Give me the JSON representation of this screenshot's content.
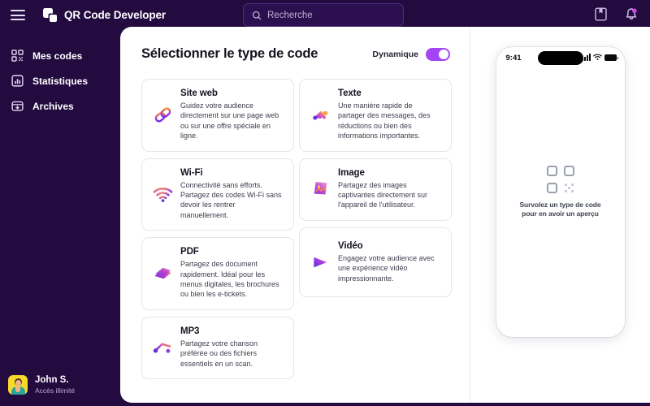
{
  "app": {
    "brand_name": "QR Code Developer",
    "brand_icon": "qr-squares-logo",
    "menu_icon": "hamburger-icon"
  },
  "search": {
    "placeholder": "Recherche",
    "value": "",
    "icon": "search-icon"
  },
  "topbar_actions": [
    {
      "name": "guide-book-icon",
      "label": ""
    },
    {
      "name": "notifications-bell-icon",
      "label": "",
      "has_badge": true
    }
  ],
  "sidebar": {
    "items": [
      {
        "label": "Mes codes",
        "icon": "qr-code-icon"
      },
      {
        "label": "Statistiques",
        "icon": "bar-chart-icon"
      },
      {
        "label": "Archives",
        "icon": "archive-box-icon"
      }
    ],
    "profile": {
      "name": "John S.",
      "subtitle": "Accès illimité",
      "avatar_icon": "user-avatar"
    }
  },
  "main": {
    "title": "Sélectionner le type de code",
    "toggle": {
      "label": "Dynamique",
      "state": "on",
      "accent": "#A445F5"
    },
    "cards_left": [
      {
        "title": "Site web",
        "desc": "Guidez votre audience directement sur une page web ou sur une offre spéciale en ligne.",
        "icon": "link-chain-icon"
      },
      {
        "title": "Wi-Fi",
        "desc": "Connectivité sans efforts. Partagez des codes Wi-Fi sans devoir les rentrer manuellement.",
        "icon": "wifi-icon"
      },
      {
        "title": "PDF",
        "desc": "Partagez des document rapidement. Idéal pour les menus digitales, les brochures ou bien les e-tickets.",
        "icon": "pdf-document-icon"
      },
      {
        "title": "MP3",
        "desc": "Partagez votre chanson préférée ou des fichiers essentiels en un scan.",
        "icon": "music-note-icon"
      }
    ],
    "cards_right": [
      {
        "title": "Texte",
        "desc": "Une manière rapide de partager des messages, des réductions ou bien des informations importantes.",
        "icon": "text-message-icon"
      },
      {
        "title": "Image",
        "desc": "Partagez des images captivantes directement sur l'appareil de l'utilisateur.",
        "icon": "image-photo-icon"
      },
      {
        "title": "Vidéo",
        "desc": "Engagez votre audience avec une expérience vidéo impressionnante.",
        "icon": "play-triangle-icon"
      }
    ]
  },
  "preview": {
    "status_time": "9:41",
    "signal_icon": "cellular-bars-icon",
    "wifi_icon": "wifi-status-icon",
    "battery_icon": "battery-icon",
    "placeholder_icon": "qr-placeholder-icon",
    "placeholder_line1": "Survolez un type de code",
    "placeholder_line2": "pour en avoir un aperçu"
  },
  "theme": {
    "sidebar_bg": "#230A3F",
    "panel_bg": "#FFFFFF",
    "accent": "#A445F5",
    "icon_purple": "#C9A6F0"
  }
}
